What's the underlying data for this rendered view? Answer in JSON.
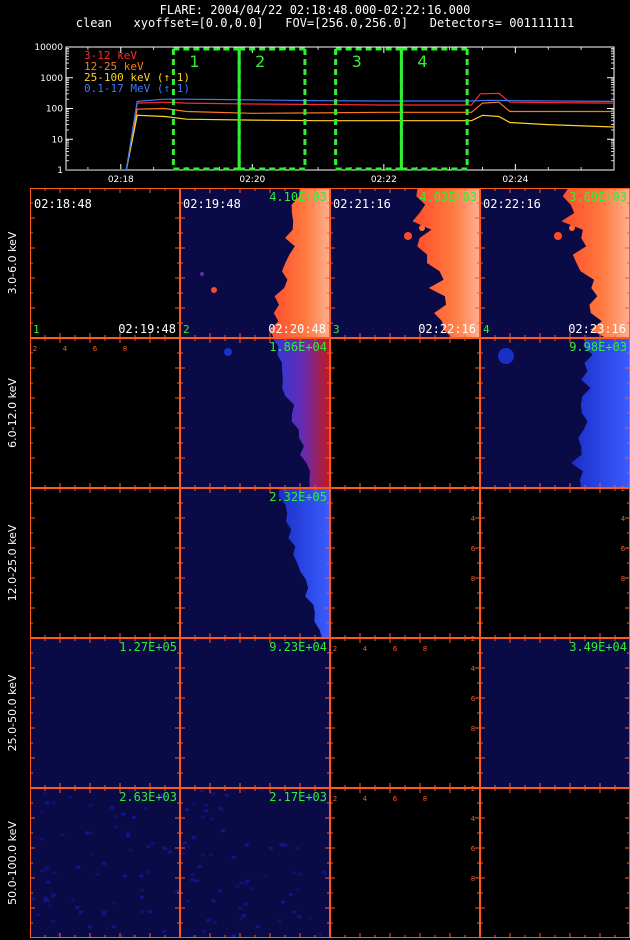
{
  "header": {
    "line1": "FLARE: 2004/04/22 02:18:48.000-02:22:16.000",
    "line2": "clean   xyoffset=[0.0,0.0]   FOV=[256.0,256.0]   Detectors= 001111111"
  },
  "chart_data": [
    {
      "type": "line",
      "yscale": "log",
      "ylim": [
        1,
        10000
      ],
      "xlim": [
        "02:17:10",
        "02:25:30"
      ],
      "x_ticks": [
        "02:18",
        "02:20",
        "02:22",
        "02:24"
      ],
      "y_ticks": [
        "1",
        "10",
        "100",
        "1000",
        "10000"
      ],
      "legend_position": "top-left",
      "series": [
        {
          "name": "3-12 keV",
          "color": "#ff2a2a",
          "points": [
            [
              "02:17:10",
              1
            ],
            [
              "02:18:05",
              1
            ],
            [
              "02:18:15",
              150
            ],
            [
              "02:18:40",
              160
            ],
            [
              "02:19:00",
              150
            ],
            [
              "02:20:00",
              140
            ],
            [
              "02:21:00",
              135
            ],
            [
              "02:22:00",
              130
            ],
            [
              "02:23:00",
              130
            ],
            [
              "02:23:20",
              130
            ],
            [
              "02:23:28",
              300
            ],
            [
              "02:23:45",
              310
            ],
            [
              "02:23:55",
              160
            ],
            [
              "02:24:30",
              155
            ],
            [
              "02:25:30",
              150
            ]
          ]
        },
        {
          "name": "12-25 keV",
          "color": "#ff7a1a",
          "points": [
            [
              "02:17:10",
              1
            ],
            [
              "02:18:05",
              1
            ],
            [
              "02:18:15",
              95
            ],
            [
              "02:18:40",
              100
            ],
            [
              "02:19:00",
              80
            ],
            [
              "02:20:00",
              70
            ],
            [
              "02:21:00",
              72
            ],
            [
              "02:22:00",
              75
            ],
            [
              "02:23:00",
              75
            ],
            [
              "02:23:20",
              75
            ],
            [
              "02:23:30",
              150
            ],
            [
              "02:23:45",
              160
            ],
            [
              "02:23:55",
              80
            ],
            [
              "02:24:30",
              80
            ],
            [
              "02:25:30",
              80
            ]
          ]
        },
        {
          "name": "25-100 keV (↑ 1)",
          "color": "#ffd21e",
          "points": [
            [
              "02:17:10",
              1
            ],
            [
              "02:18:05",
              1
            ],
            [
              "02:18:15",
              60
            ],
            [
              "02:18:40",
              55
            ],
            [
              "02:19:00",
              45
            ],
            [
              "02:20:00",
              42
            ],
            [
              "02:21:00",
              40
            ],
            [
              "02:22:00",
              40
            ],
            [
              "02:23:00",
              40
            ],
            [
              "02:23:20",
              40
            ],
            [
              "02:23:30",
              60
            ],
            [
              "02:23:45",
              55
            ],
            [
              "02:23:55",
              35
            ],
            [
              "02:24:30",
              30
            ],
            [
              "02:25:30",
              25
            ]
          ]
        },
        {
          "name": "0.1-17 MeV (↑ 1)",
          "color": "#3b7bff",
          "points": [
            [
              "02:17:10",
              1
            ],
            [
              "02:18:05",
              1
            ],
            [
              "02:18:15",
              170
            ],
            [
              "02:18:40",
              200
            ],
            [
              "02:19:00",
              200
            ],
            [
              "02:20:00",
              190
            ],
            [
              "02:21:00",
              180
            ],
            [
              "02:22:00",
              175
            ],
            [
              "02:23:00",
              175
            ],
            [
              "02:23:20",
              175
            ],
            [
              "02:23:35",
              185
            ],
            [
              "02:24:00",
              180
            ],
            [
              "02:25:30",
              170
            ]
          ]
        }
      ],
      "windows": [
        {
          "label": "1",
          "start": "02:18:48",
          "end": "02:19:48"
        },
        {
          "label": "2",
          "start": "02:19:48",
          "end": "02:20:48"
        },
        {
          "label": "3",
          "start": "02:21:16",
          "end": "02:22:16"
        },
        {
          "label": "4",
          "start": "02:22:16",
          "end": "02:23:16"
        }
      ]
    },
    {
      "type": "heatmap",
      "rows": [
        "3.0-6.0 keV",
        "6.0-12.0 keV",
        "12.0-25.0 keV",
        "25.0-50.0 keV",
        "50.0-100.0 keV"
      ],
      "axis_ticks": [
        "2",
        "4",
        "6",
        "8"
      ],
      "panels": [
        [
          {
            "start": "02:18:48",
            "end": "02:19:48",
            "index": "1",
            "peak": "",
            "image": "black"
          },
          {
            "start": "02:19:48",
            "end": "02:20:48",
            "index": "2",
            "peak": "4.10E+03",
            "image": "fire-right"
          },
          {
            "start": "02:21:16",
            "end": "02:22:16",
            "index": "3",
            "peak": "4.03E+03",
            "image": "fire-full"
          },
          {
            "start": "02:22:16",
            "end": "02:23:16",
            "index": "4",
            "peak": "3.69E+03",
            "image": "fire-full"
          }
        ],
        [
          {
            "peak": "",
            "image": "black"
          },
          {
            "peak": "1.86E+04",
            "image": "blue-red-edge"
          },
          {
            "peak": "",
            "image": "black"
          },
          {
            "peak": "9.98E+03",
            "image": "blue-edge"
          }
        ],
        [
          {
            "peak": "",
            "image": "black"
          },
          {
            "peak": "2.32E+05",
            "image": "blue-edge-bright"
          },
          {
            "peak": "",
            "image": "black"
          },
          {
            "peak": "",
            "image": "black"
          }
        ],
        [
          {
            "peak": "1.27E+05",
            "image": "navy"
          },
          {
            "peak": "9.23E+04",
            "image": "navy"
          },
          {
            "peak": "",
            "image": "black"
          },
          {
            "peak": "3.49E+04",
            "image": "navy"
          }
        ],
        [
          {
            "peak": "2.63E+03",
            "image": "navy-noise"
          },
          {
            "peak": "2.17E+03",
            "image": "navy-noise"
          },
          {
            "peak": "",
            "image": "black"
          },
          {
            "peak": "",
            "image": "black"
          }
        ]
      ]
    }
  ],
  "colors": {
    "frame": "#ff5a1e",
    "window_box": "#33ee33",
    "navy": "#0a0a46",
    "fire_orange": "#ff6a3a"
  }
}
